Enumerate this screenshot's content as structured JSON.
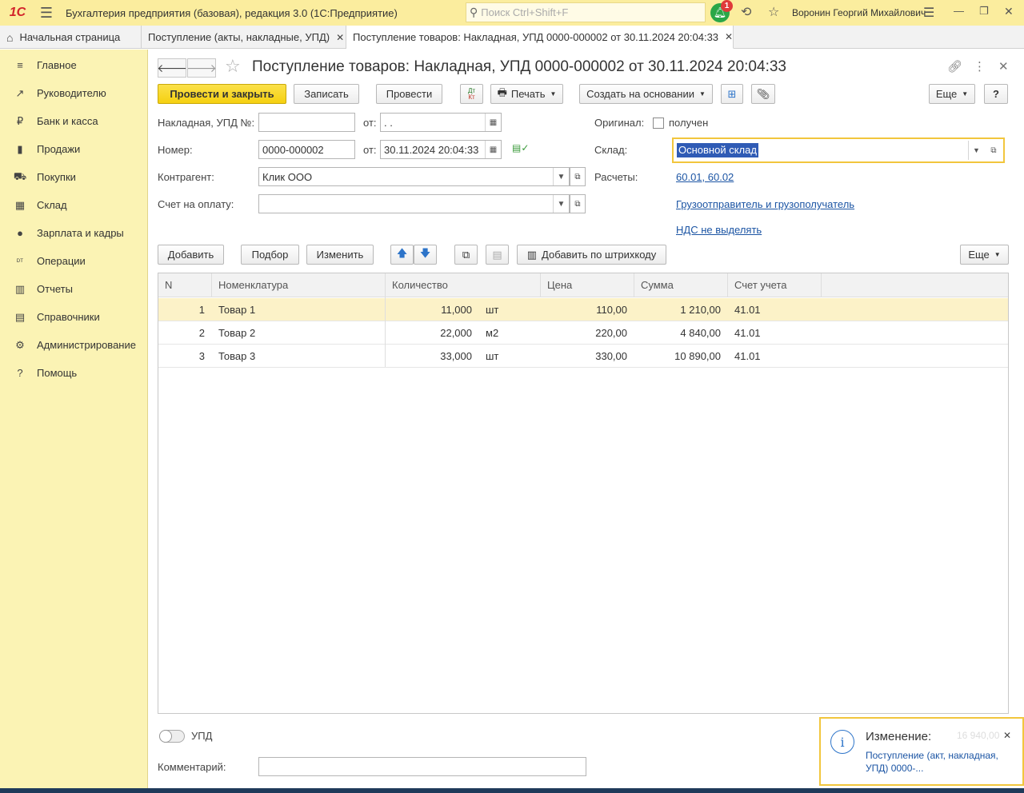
{
  "topbar": {
    "logo": "1С",
    "title": "Бухгалтерия предприятия (базовая), редакция 3.0  (1С:Предприятие)",
    "search_placeholder": "Поиск Ctrl+Shift+F",
    "notification_count": "1",
    "user": "Воронин Георгий Михайлович"
  },
  "tabs": [
    {
      "label": "Начальная страница"
    },
    {
      "label": "Поступление (акты, накладные, УПД)"
    },
    {
      "label": "Поступление товаров: Накладная, УПД 0000-000002 от 30.11.2024 20:04:33"
    }
  ],
  "sidebar": {
    "items": [
      {
        "label": "Главное",
        "icon": "≡"
      },
      {
        "label": "Руководителю",
        "icon": "↗"
      },
      {
        "label": "Банк и касса",
        "icon": "₽"
      },
      {
        "label": "Продажи",
        "icon": "▮"
      },
      {
        "label": "Покупки",
        "icon": "⛟"
      },
      {
        "label": "Склад",
        "icon": "▦"
      },
      {
        "label": "Зарплата и кадры",
        "icon": "●"
      },
      {
        "label": "Операции",
        "icon": "ᴰᵀ"
      },
      {
        "label": "Отчеты",
        "icon": "▥"
      },
      {
        "label": "Справочники",
        "icon": "▤"
      },
      {
        "label": "Администрирование",
        "icon": "⚙"
      },
      {
        "label": "Помощь",
        "icon": "?"
      }
    ]
  },
  "document": {
    "title": "Поступление товаров: Накладная, УПД 0000-000002 от 30.11.2024 20:04:33"
  },
  "toolbar": {
    "post_close": "Провести и закрыть",
    "save": "Записать",
    "post": "Провести",
    "dtkt": "ДТКТ",
    "print": "Печать",
    "create_based": "Создать на основании",
    "more": "Еще",
    "help": "?"
  },
  "form": {
    "invoice_label": "Накладная, УПД №:",
    "invoice_value": "",
    "from_label": "от:",
    "invoice_date": " .  .",
    "number_label": "Номер:",
    "number_value": "0000-000002",
    "number_date": "30.11.2024 20:04:33",
    "counterparty_label": "Контрагент:",
    "counterparty_value": "Клик ООО",
    "payment_invoice_label": "Счет на оплату:",
    "payment_invoice_value": "",
    "original_label": "Оригинал:",
    "original_checkbox": "получен",
    "warehouse_label": "Склад:",
    "warehouse_value": "Основной склад",
    "settlements_label": "Расчеты:",
    "settlements_link": "60.01, 60.02",
    "consignor_link": "Грузоотправитель и грузополучатель",
    "vat_link": "НДС не выделять"
  },
  "table_toolbar": {
    "add": "Добавить",
    "pick": "Подбор",
    "edit": "Изменить",
    "add_barcode": "Добавить по штрихкоду",
    "more": "Еще"
  },
  "table": {
    "headers": [
      "N",
      "Номенклатура",
      "Количество",
      "Цена",
      "Сумма",
      "Счет учета"
    ],
    "rows": [
      {
        "n": "1",
        "item": "Товар 1",
        "qty": "11,000",
        "unit": "шт",
        "price": "110,00",
        "sum": "1 210,00",
        "account": "41.01"
      },
      {
        "n": "2",
        "item": "Товар 2",
        "qty": "22,000",
        "unit": "м2",
        "price": "220,00",
        "sum": "4 840,00",
        "account": "41.01"
      },
      {
        "n": "3",
        "item": "Товар 3",
        "qty": "33,000",
        "unit": "шт",
        "price": "330,00",
        "sum": "10 890,00",
        "account": "41.01"
      }
    ]
  },
  "bottom": {
    "upd_label": "УПД",
    "comment_label": "Комментарий:",
    "comment_value": ""
  },
  "notification": {
    "title": "Изменение:",
    "body": "Поступление (акт, накладная, УПД) 0000-...",
    "background_total": "16 940,00"
  }
}
